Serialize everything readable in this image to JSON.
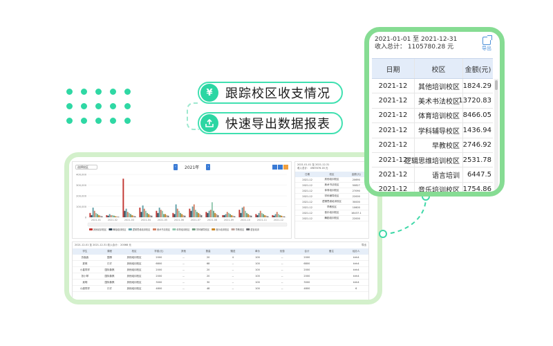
{
  "features": [
    {
      "icon": "¥",
      "text": "跟踪校区收支情况"
    },
    {
      "icon": "⇪",
      "text": "快速导出数据报表"
    }
  ],
  "colors": {
    "accent": "#2fd8a4",
    "frame_main": "#d3f0cb",
    "frame_zoom": "#86dc93",
    "header_bg": "#e3ecf9",
    "link": "#4a8fd8"
  },
  "zoom": {
    "date_range": "2021-01-01 至 2021-12-31",
    "total": "收入总计： 1105780.28 元",
    "export_label": "导出",
    "columns": [
      "日期",
      "校区",
      "金额(元)"
    ],
    "rows": [
      {
        "date": "2021-12",
        "campus": "其他培训校区",
        "amount": "1824.29"
      },
      {
        "date": "2021-12",
        "campus": "美术书法校区",
        "amount": "13720.83"
      },
      {
        "date": "2021-12",
        "campus": "体育培训校区",
        "amount": "8466.05"
      },
      {
        "date": "2021-12",
        "campus": "学科辅导校区",
        "amount": "1436.94"
      },
      {
        "date": "2021-12",
        "campus": "早教校区",
        "amount": "2746.92"
      },
      {
        "date": "2021-12",
        "campus": "逻辑思维培训校区",
        "amount": "2531.78"
      },
      {
        "date": "2021-12",
        "campus": "语言培训",
        "amount": "6447.5"
      },
      {
        "date": "2021-12",
        "campus": "音乐培训校区",
        "amount": "1754.86"
      }
    ]
  },
  "main": {
    "select_label": "选择校区",
    "year_label": "2021年",
    "side_head1": "2021-01-01 至 2021-12-31",
    "side_head2": "收入总计：  4987876.16 元",
    "side_columns": [
      "日期",
      "校区",
      "金额(元)"
    ],
    "side_rows": [
      [
        "2021-12",
        "其他培训校区",
        "20690"
      ],
      [
        "2021-12",
        "美术书法校区",
        "50827"
      ],
      [
        "2021-12",
        "体育培训校区",
        "27090"
      ],
      [
        "2021-12",
        "学科辅导校区",
        "22000"
      ],
      [
        "2021-12",
        "逻辑思维培训校区",
        "30000"
      ],
      [
        "2021-12",
        "早教校区",
        "10600"
      ],
      [
        "2021-12",
        "音乐培训校区",
        "16437.1"
      ],
      [
        "2021-12",
        "舞蹈培训校区",
        "22000"
      ]
    ],
    "bottom_head": "2021-12-01 至 2021-12-31  收入合计：  20068 元",
    "bottom_export": "导出",
    "bottom_columns": [
      "学生",
      "课程",
      "校区",
      "学费(元)",
      "其他",
      "数量",
      "赠送",
      "单价",
      "优惠",
      "合计",
      "备注",
      "经办人"
    ],
    "bottom_rows": [
      [
        "苏鑫鑫",
        "围棋",
        "其他培训校区",
        "2000",
        "--",
        "20",
        "4",
        "100",
        "--",
        "2000",
        "",
        "kirk4"
      ],
      [
        "夏琪",
        "口才",
        "其他培训校区",
        "6800",
        "--",
        "68",
        "--",
        "100",
        "--",
        "6800",
        "",
        "kirk4"
      ],
      [
        "小星同学",
        "国际象棋",
        "其他培训校区",
        "2000",
        "--",
        "20",
        "--",
        "100",
        "--",
        "2000",
        "",
        "kirk4"
      ],
      [
        "张小琴",
        "国际象棋",
        "其他培训校区",
        "2000",
        "--",
        "20",
        "--",
        "100",
        "--",
        "2000",
        "",
        "kirk4"
      ],
      [
        "吴明",
        "国际象棋",
        "其他培训校区",
        "3000",
        "--",
        "30",
        "--",
        "100",
        "--",
        "3000",
        "",
        "kirk4"
      ],
      [
        "小超同学",
        "口才",
        "其他培训校区",
        "4800",
        "--",
        "48",
        "--",
        "100",
        "--",
        "4800",
        "",
        "6"
      ]
    ]
  },
  "chart_data": {
    "type": "bar",
    "categories": [
      "2021-01",
      "2021-02",
      "2021-03",
      "2021-04",
      "2021-05",
      "2021-06",
      "2021-07",
      "2021-08",
      "2021-09",
      "2021-10",
      "2021-11",
      "2021-12"
    ],
    "yticks": [
      "400,000",
      "300,000",
      "200,000",
      "100,000",
      "0"
    ],
    "ylim": [
      0,
      400000
    ],
    "series": [
      {
        "name": "其他培训校区",
        "color": "#c23531",
        "values": [
          40000,
          20000,
          360000,
          90000,
          60000,
          40000,
          80000,
          50000,
          20000,
          70000,
          30000,
          20000
        ]
      },
      {
        "name": "舞蹈培训校区",
        "color": "#2f4554",
        "values": [
          20000,
          15000,
          60000,
          50000,
          40000,
          30000,
          60000,
          40000,
          20000,
          40000,
          20000,
          15000
        ]
      },
      {
        "name": "逻辑思维培训校区",
        "color": "#61a0a8",
        "values": [
          90000,
          30000,
          80000,
          110000,
          90000,
          120000,
          100000,
          60000,
          30000,
          90000,
          40000,
          30000
        ]
      },
      {
        "name": "美术书法校区",
        "color": "#d48265",
        "values": [
          60000,
          20000,
          50000,
          80000,
          70000,
          80000,
          120000,
          70000,
          50000,
          100000,
          60000,
          50000
        ]
      },
      {
        "name": "体育培训校区",
        "color": "#91c7ae",
        "values": [
          40000,
          20000,
          40000,
          60000,
          60000,
          60000,
          70000,
          140000,
          40000,
          60000,
          40000,
          30000
        ]
      },
      {
        "name": "学科辅导校区",
        "color": "#749f83",
        "values": [
          30000,
          15000,
          30000,
          40000,
          30000,
          40000,
          50000,
          60000,
          30000,
          40000,
          30000,
          20000
        ]
      },
      {
        "name": "音乐培训校区",
        "color": "#ca8622",
        "values": [
          20000,
          10000,
          20000,
          30000,
          30000,
          30000,
          40000,
          40000,
          20000,
          30000,
          20000,
          15000
        ]
      },
      {
        "name": "早教校区",
        "color": "#bda29a",
        "values": [
          15000,
          8000,
          15000,
          20000,
          20000,
          20000,
          30000,
          30000,
          15000,
          20000,
          15000,
          10000
        ]
      },
      {
        "name": "语言培训",
        "color": "#6e7074",
        "values": [
          10000,
          5000,
          10000,
          15000,
          15000,
          15000,
          20000,
          20000,
          10000,
          15000,
          10000,
          8000
        ]
      }
    ]
  }
}
